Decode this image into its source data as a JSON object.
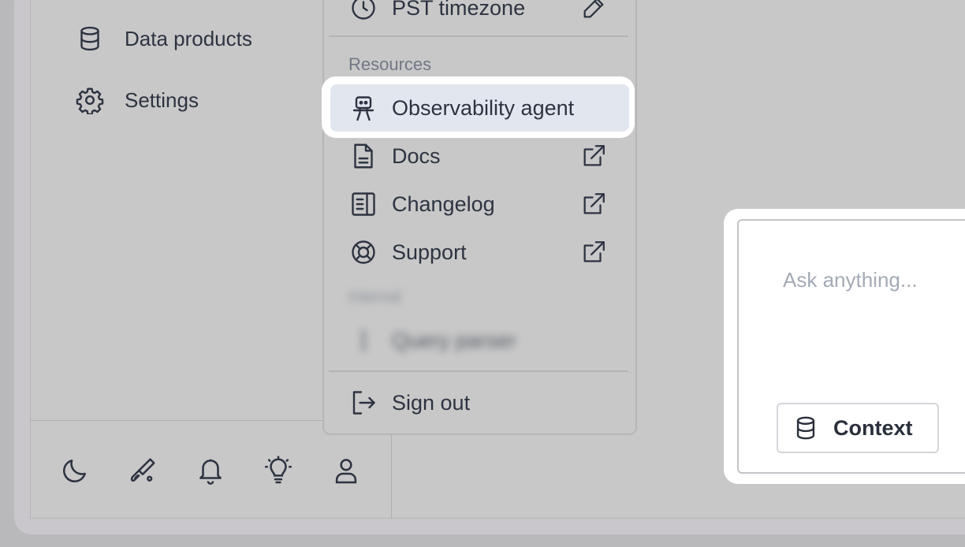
{
  "sidebar": {
    "items": [
      {
        "label": "Data products",
        "icon": "database-icon"
      },
      {
        "label": "Settings",
        "icon": "gear-icon"
      }
    ],
    "footer_icons": [
      "moon-icon",
      "paint-brush-icon",
      "bell-icon",
      "lightbulb-icon",
      "user-icon"
    ]
  },
  "menu": {
    "timezone_label": "PST timezone",
    "resources_heading": "Resources",
    "items": [
      {
        "label": "Observability agent",
        "icon": "robot-icon",
        "highlighted": true
      },
      {
        "label": "Docs",
        "icon": "document-icon",
        "external": true
      },
      {
        "label": "Changelog",
        "icon": "changelog-icon",
        "external": true
      },
      {
        "label": "Support",
        "icon": "lifebuoy-icon",
        "external": true
      }
    ],
    "internal_heading": "Internal",
    "internal_items": [
      {
        "label": "Query parser"
      }
    ],
    "sign_out_label": "Sign out"
  },
  "chat": {
    "placeholder": "Ask anything...",
    "context_button": "Context"
  },
  "colors": {
    "highlight": "#e2e7ef",
    "text": "#2d3340",
    "muted": "#717784"
  }
}
